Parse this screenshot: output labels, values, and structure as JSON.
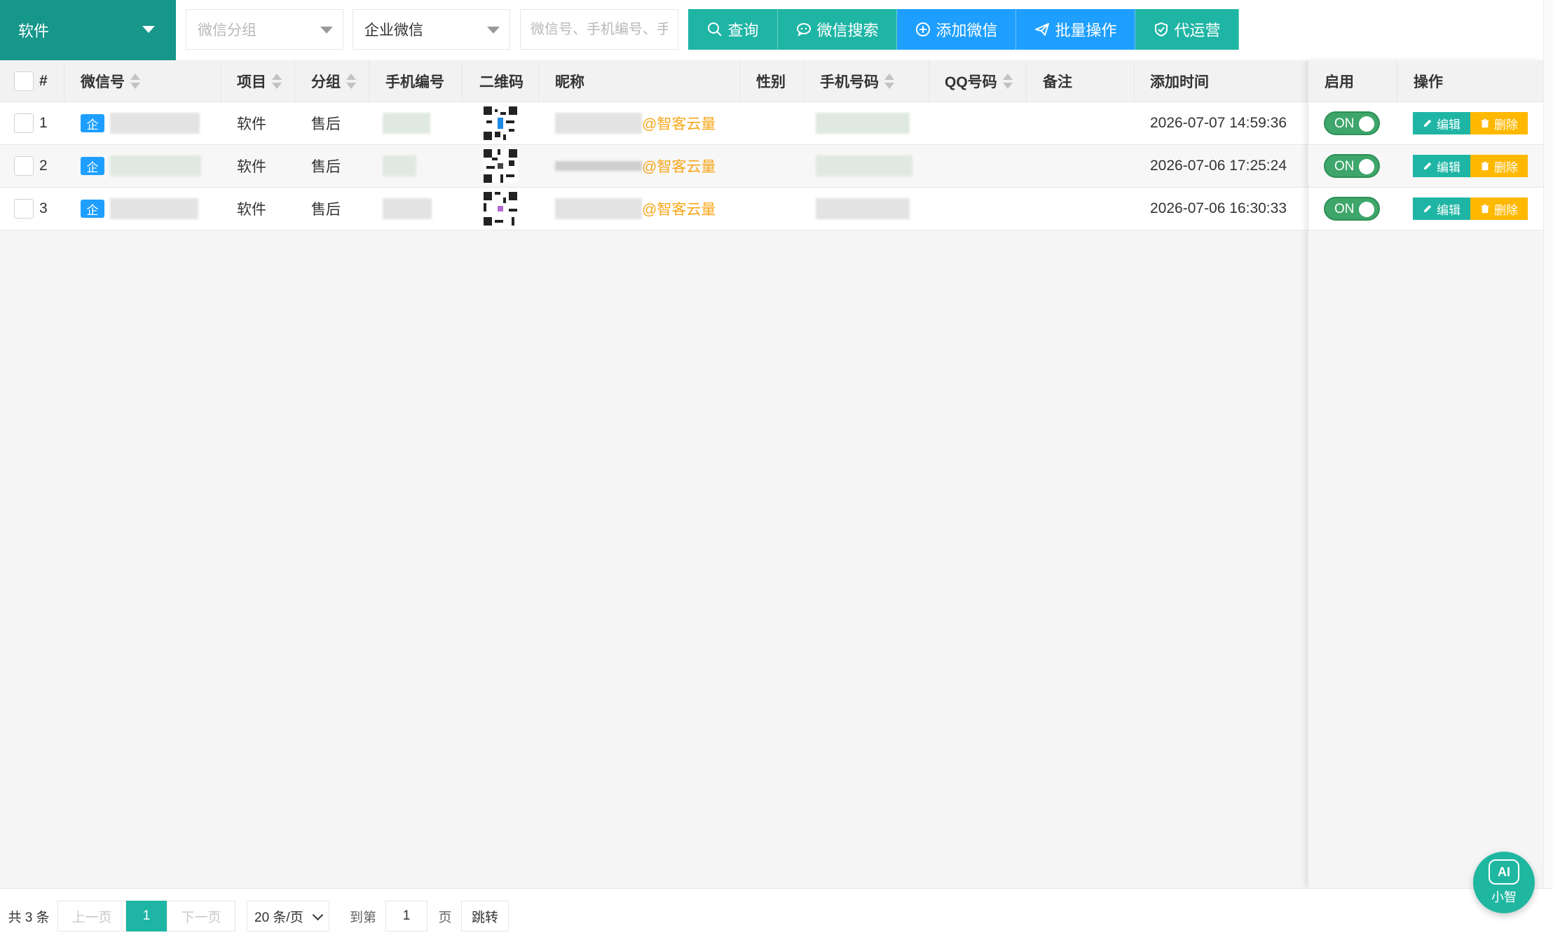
{
  "toolbar": {
    "project_select": "软件",
    "group_select_placeholder": "微信分组",
    "type_select_value": "企业微信",
    "search_placeholder": "微信号、手机编号、手",
    "buttons": {
      "query": "查询",
      "wechat_search": "微信搜索",
      "add_wechat": "添加微信",
      "batch_ops": "批量操作",
      "agent_ops": "代运营"
    }
  },
  "table": {
    "headers": {
      "index": "#",
      "wechat_id": "微信号",
      "project": "项目",
      "group": "分组",
      "phone_no": "手机编号",
      "qrcode": "二维码",
      "nickname": "昵称",
      "gender": "性别",
      "phone": "手机号码",
      "qq": "QQ号码",
      "remark": "备注",
      "added_time": "添加时间",
      "enabled": "启用",
      "actions": "操作"
    },
    "rows": [
      {
        "index": "1",
        "badge": "企",
        "project": "软件",
        "group": "售后",
        "nickname_suffix": "@智客云量",
        "gender": "",
        "qq": "",
        "remark": "",
        "added_time": "2026-07-07 14:59:36",
        "enabled": "ON",
        "edit": "编辑",
        "delete": "删除"
      },
      {
        "index": "2",
        "badge": "企",
        "project": "软件",
        "group": "售后",
        "nickname_suffix": "@智客云量",
        "gender": "",
        "qq": "",
        "remark": "",
        "added_time": "2026-07-06 17:25:24",
        "enabled": "ON",
        "edit": "编辑",
        "delete": "删除"
      },
      {
        "index": "3",
        "badge": "企",
        "project": "软件",
        "group": "售后",
        "nickname_suffix": "@智客云量",
        "gender": "",
        "qq": "",
        "remark": "",
        "added_time": "2026-07-06 16:30:33",
        "enabled": "ON",
        "edit": "编辑",
        "delete": "删除"
      }
    ]
  },
  "pagination": {
    "total": "共 3 条",
    "prev": "上一页",
    "current": "1",
    "next": "下一页",
    "page_size": "20 条/页",
    "goto_label": "到第",
    "goto_value": "1",
    "page_unit": "页",
    "jump": "跳转"
  },
  "ai_assistant": {
    "icon_text": "AI",
    "label": "小智"
  },
  "colors": {
    "primary_teal": "#1fb5a5",
    "project_bar": "#17968a",
    "blue": "#1e9fff",
    "warning": "#ffb800",
    "nickname_suffix": "#f7a618",
    "toggle_on": "#3ea66a"
  }
}
